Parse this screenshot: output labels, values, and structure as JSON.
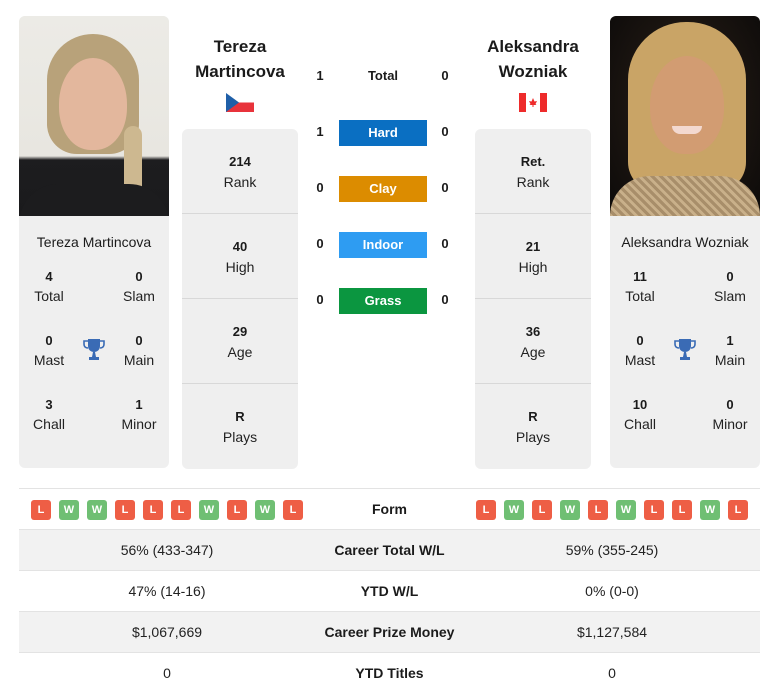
{
  "players": [
    {
      "name_line1": "Tereza",
      "name_line2": "Martincova",
      "full_name": "Tereza Martincova",
      "country": "Czech Republic",
      "flag_icon": "czech-flag-icon",
      "titles": {
        "total": {
          "value": "4",
          "label": "Total"
        },
        "slam": {
          "value": "0",
          "label": "Slam"
        },
        "mast": {
          "value": "0",
          "label": "Mast"
        },
        "main": {
          "value": "0",
          "label": "Main"
        },
        "chall": {
          "value": "3",
          "label": "Chall"
        },
        "minor": {
          "value": "1",
          "label": "Minor"
        }
      },
      "stats": [
        {
          "value": "214",
          "label": "Rank"
        },
        {
          "value": "40",
          "label": "High"
        },
        {
          "value": "29",
          "label": "Age"
        },
        {
          "value": "R",
          "label": "Plays"
        }
      ],
      "form": [
        "L",
        "W",
        "W",
        "L",
        "L",
        "L",
        "W",
        "L",
        "W",
        "L"
      ],
      "career_total_wl": "56% (433-347)",
      "ytd_wl": "47% (14-16)",
      "career_prize_money": "$1,067,669",
      "ytd_titles": "0"
    },
    {
      "name_line1": "Aleksandra",
      "name_line2": "Wozniak",
      "full_name": "Aleksandra Wozniak",
      "country": "Canada",
      "flag_icon": "canada-flag-icon",
      "titles": {
        "total": {
          "value": "11",
          "label": "Total"
        },
        "slam": {
          "value": "0",
          "label": "Slam"
        },
        "mast": {
          "value": "0",
          "label": "Mast"
        },
        "main": {
          "value": "1",
          "label": "Main"
        },
        "chall": {
          "value": "10",
          "label": "Chall"
        },
        "minor": {
          "value": "0",
          "label": "Minor"
        }
      },
      "stats": [
        {
          "value": "Ret.",
          "label": "Rank"
        },
        {
          "value": "21",
          "label": "High"
        },
        {
          "value": "36",
          "label": "Age"
        },
        {
          "value": "R",
          "label": "Plays"
        }
      ],
      "form": [
        "L",
        "W",
        "L",
        "W",
        "L",
        "W",
        "L",
        "L",
        "W",
        "L"
      ],
      "career_total_wl": "59% (355-245)",
      "ytd_wl": "0% (0-0)",
      "career_prize_money": "$1,127,584",
      "ytd_titles": "0"
    }
  ],
  "h2h": {
    "total": {
      "label": "Total",
      "left": "1",
      "right": "0"
    },
    "surfaces": [
      {
        "label": "Hard",
        "left": "1",
        "right": "0",
        "color": "#0a6fc2"
      },
      {
        "label": "Clay",
        "left": "0",
        "right": "0",
        "color": "#dc8c00"
      },
      {
        "label": "Indoor",
        "left": "0",
        "right": "0",
        "color": "#2e9cf2"
      },
      {
        "label": "Grass",
        "left": "0",
        "right": "0",
        "color": "#0b9640"
      }
    ]
  },
  "comparison": {
    "form_label": "Form",
    "career_total_wl_label": "Career Total W/L",
    "ytd_wl_label": "YTD W/L",
    "career_prize_money_label": "Career Prize Money",
    "ytd_titles_label": "YTD Titles"
  },
  "colors": {
    "loss": "#ee5e45",
    "win": "#6fbf73",
    "trophy": "#3a6bb5",
    "card_bg": "#efefef"
  }
}
